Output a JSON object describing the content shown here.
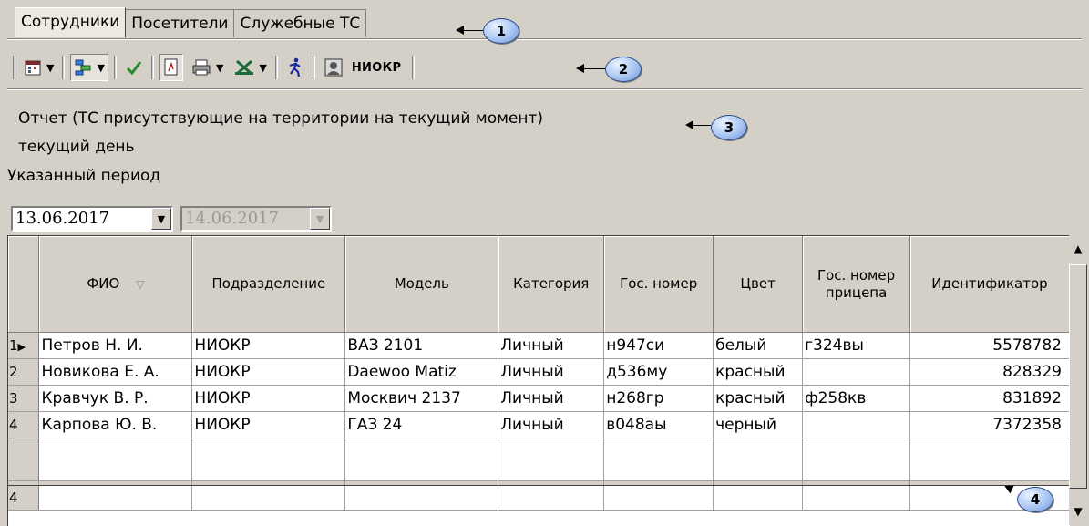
{
  "tabs": [
    "Сотрудники",
    "Посетители",
    "Служебные ТС"
  ],
  "callouts": [
    "1",
    "2",
    "3",
    "4"
  ],
  "toolbar": {
    "icons": [
      "calendar-icon",
      "layout-icon",
      "checkmark-icon",
      "report-icon",
      "print-icon",
      "excel-icon",
      "person-run-icon",
      "user-card-icon"
    ],
    "department_label": "НИОКР"
  },
  "report": {
    "title": "Отчет (ТС присутствующие на территории на текущий момент)",
    "subtitle": "текущий день"
  },
  "period": {
    "label": "Указанный период",
    "from": "13.06.2017",
    "to": "14.06.2017"
  },
  "table": {
    "columns": [
      "ФИО",
      "Подразделение",
      "Модель",
      "Категория",
      "Гос. номер",
      "Цвет",
      "Гос. номер прицепа",
      "Идентификатор"
    ],
    "rows": [
      {
        "n": "1",
        "fio": "Петров Н. И.",
        "dept": "НИОКР",
        "model": "ВАЗ 2101",
        "cat": "Личный",
        "plate": "н947си",
        "color": "белый",
        "trailer": "г324вы",
        "id": "5578782"
      },
      {
        "n": "2",
        "fio": "Новикова Е. А.",
        "dept": "НИОКР",
        "model": "Daewoo Matiz",
        "cat": "Личный",
        "plate": "д536му",
        "color": "красный",
        "trailer": "",
        "id": "828329"
      },
      {
        "n": "3",
        "fio": "Кравчук В. Р.",
        "dept": "НИОКР",
        "model": "Москвич 2137",
        "cat": "Личный",
        "plate": "н268гр",
        "color": "красный",
        "trailer": "ф258кв",
        "id": "831892"
      },
      {
        "n": "4",
        "fio": "Карпова Ю. В.",
        "dept": "НИОКР",
        "model": "ГАЗ 24",
        "cat": "Личный",
        "plate": "в048аы",
        "color": "черный",
        "trailer": "",
        "id": "7372358"
      }
    ],
    "footer_count": "4"
  }
}
